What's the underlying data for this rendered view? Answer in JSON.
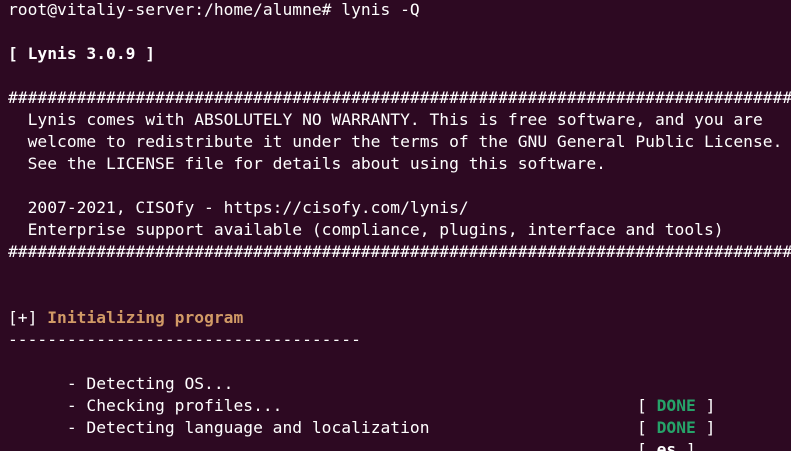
{
  "terminal": {
    "prompt": "root@vitaliy-server:/home/alumne# lynis -Q",
    "version": "[ Lynis 3.0.9 ]",
    "separator": "##################################################################################################",
    "license_lines": [
      "  Lynis comes with ABSOLUTELY NO WARRANTY. This is free software, and you are",
      "  welcome to redistribute it under the terms of the GNU General Public License.",
      "  See the LICENSE file for details about using this software."
    ],
    "copyright": "  2007-2021, CISOfy - https://cisofy.com/lynis/",
    "enterprise": "  Enterprise support available (compliance, plugins, interface and tools)",
    "section": {
      "marker": "[+]",
      "title": "Initializing program",
      "underline": "------------------------------------"
    },
    "checks": [
      {
        "label": "  - Detecting OS...",
        "open": "[ ",
        "status": "DONE",
        "close": " ]",
        "status_color": "#26a269"
      },
      {
        "label": "  - Checking profiles...",
        "open": "[ ",
        "status": "DONE",
        "close": " ]",
        "status_color": "#26a269"
      },
      {
        "label": "  - Detecting language and localization",
        "open": "[ ",
        "status": "es",
        "close": " ]",
        "status_color": "#ffffff"
      }
    ]
  },
  "colors": {
    "background": "#2d0922",
    "text": "#ffffff",
    "section_title": "#d19a66",
    "done": "#26a269"
  }
}
